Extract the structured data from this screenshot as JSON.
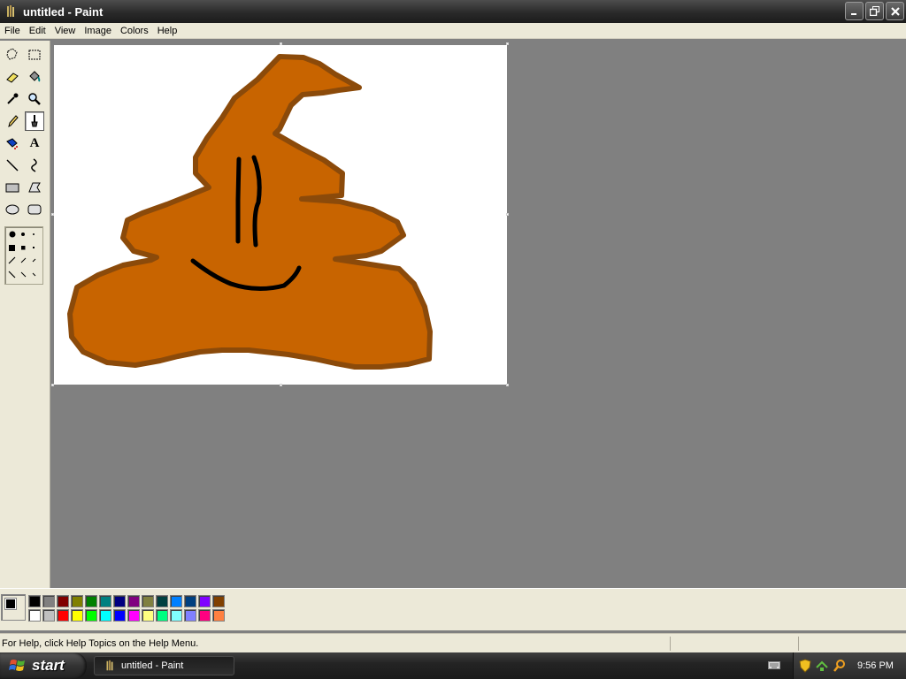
{
  "window": {
    "title": "untitled - Paint"
  },
  "menu": [
    "File",
    "Edit",
    "View",
    "Image",
    "Colors",
    "Help"
  ],
  "tools": [
    {
      "name": "free-form-select-icon"
    },
    {
      "name": "select-icon"
    },
    {
      "name": "eraser-icon"
    },
    {
      "name": "fill-bucket-icon"
    },
    {
      "name": "pick-color-icon"
    },
    {
      "name": "magnifier-icon"
    },
    {
      "name": "pencil-icon"
    },
    {
      "name": "brush-icon",
      "active": true
    },
    {
      "name": "airbrush-icon"
    },
    {
      "name": "text-icon",
      "glyph": "A"
    },
    {
      "name": "line-icon"
    },
    {
      "name": "curve-icon"
    },
    {
      "name": "rectangle-icon"
    },
    {
      "name": "polygon-icon"
    },
    {
      "name": "ellipse-icon"
    },
    {
      "name": "rounded-rectangle-icon"
    }
  ],
  "palette": {
    "foreground": "#000000",
    "background": "#ffffff",
    "row1": [
      "#000000",
      "#808080",
      "#800000",
      "#808000",
      "#008000",
      "#008080",
      "#000080",
      "#800080",
      "#808040",
      "#004040",
      "#0080ff",
      "#004080",
      "#8000ff",
      "#804000"
    ],
    "row2": [
      "#ffffff",
      "#c0c0c0",
      "#ff0000",
      "#ffff00",
      "#00ff00",
      "#00ffff",
      "#0000ff",
      "#ff00ff",
      "#ffff80",
      "#00ff80",
      "#80ffff",
      "#8080ff",
      "#ff0080",
      "#ff8040"
    ]
  },
  "drawing": {
    "fill": "#c86400",
    "outline": "#8b4a0a",
    "stroke": "#000000"
  },
  "status": {
    "help_text": "For Help, click Help Topics on the Help Menu."
  },
  "taskbar": {
    "start_label": "start",
    "task_label": "untitled - Paint",
    "clock": "9:56 PM"
  }
}
